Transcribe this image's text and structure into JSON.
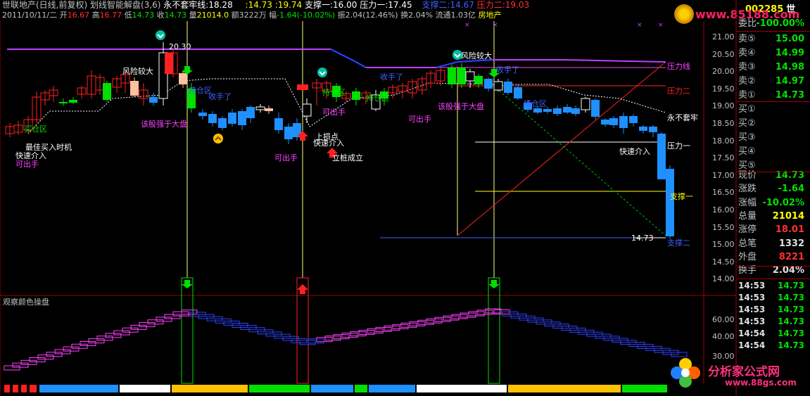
{
  "header": {
    "stock_name": "世联地产(日线,前复权)",
    "indicator": "划线智能解盘(3,6)",
    "line_label": "永不套牢线:",
    "line_value": "18.28",
    "price_value": ":14.73",
    "price_value2": ":19.74",
    "support1_label": "支撑一:",
    "support1_value": "16.00",
    "pressure1_label": "压力一:",
    "pressure1_value": "17.45",
    "support2_label": "支撑二:",
    "support2_value": "14.67",
    "pressure2_label": "压力二:",
    "pressure2_value": "19.03",
    "date": "2011/10/11/二",
    "open_label": "开",
    "open": "16.67",
    "high_label": "高",
    "high": "16.77",
    "low_label": "低",
    "low": "14.73",
    "close_label": "收",
    "close": "14.73",
    "volume_label": "量",
    "volume": "21014.0",
    "amount_label": "额",
    "amount": "3222万",
    "change_label": "幅",
    "change": "-1.64(-10.02%)",
    "amplitude_label": "振",
    "amplitude": "2.04(12.46%)",
    "turnover_label": "换",
    "turnover": "2.04%",
    "float_label": "流通",
    "float": "1.03亿",
    "sector": "房地产",
    "code": "002285",
    "code_suffix": "世"
  },
  "watermark_top": "www.85188.com",
  "axis": {
    "main": [
      "21.00",
      "20.50",
      "20.00",
      "19.50",
      "19.00",
      "18.50",
      "18.00",
      "17.50",
      "17.00",
      "16.50",
      "16.00",
      "15.50",
      "15.00",
      "14.50",
      "14.00"
    ],
    "sub": [
      "60.00",
      "40.00",
      "30.00"
    ]
  },
  "chart_labels": {
    "risk1": "风险较大",
    "risk2": "风险较大",
    "peak": "20.30",
    "stop1": "收手了",
    "stop2": "收手了",
    "stop3": "收手了",
    "hold1": "持仓区",
    "hold2": "持仓区",
    "hold3": "持仓区",
    "hold4": "持仓区",
    "strong1": "该股强于大盘",
    "strong2": "该股强于大盘",
    "can_sell1": "可出手",
    "can_sell2": "可出手",
    "can_sell3": "可出手",
    "can_sell4": "可出手",
    "quick1": "快速介入",
    "quick2": "快速介入",
    "quick3": "快速介入",
    "best_buy": "最佳买入时机",
    "up_point": "上损点",
    "stand": "立桩成立",
    "buy_zone": "买仓区",
    "right_never": "永不套牢",
    "right_p1": "压力一",
    "right_p2": "压力二",
    "right_pline": "压力线",
    "right_s1": "支撑一",
    "right_s2": "支撑二",
    "last_price": "14.73"
  },
  "sub_panel_title": "观察颜色操盘",
  "quote_panel": {
    "ratio_label": "委比",
    "ratio_value": "-100.00%",
    "sell": [
      {
        "label": "卖⑤",
        "value": "15.00"
      },
      {
        "label": "卖④",
        "value": "14.99"
      },
      {
        "label": "卖③",
        "value": "14.98"
      },
      {
        "label": "卖②",
        "value": "14.97"
      },
      {
        "label": "卖①",
        "value": "14.73"
      }
    ],
    "buy": [
      {
        "label": "买①",
        "value": ""
      },
      {
        "label": "买②",
        "value": ""
      },
      {
        "label": "买③",
        "value": ""
      },
      {
        "label": "买④",
        "value": ""
      },
      {
        "label": "买⑤",
        "value": ""
      }
    ],
    "stats": [
      {
        "label": "现价",
        "value": "14.73",
        "color": "#00e000"
      },
      {
        "label": "涨跌",
        "value": "-1.64",
        "color": "#00e000"
      },
      {
        "label": "涨幅",
        "value": "-10.02%",
        "color": "#00e000"
      },
      {
        "label": "总量",
        "value": "21014",
        "color": "#ffff00"
      },
      {
        "label": "涨停",
        "value": "18.01",
        "color": "#ff3030"
      },
      {
        "label": "总笔",
        "value": "1332",
        "color": "#e0e0e0"
      },
      {
        "label": "外盘",
        "value": "8221",
        "color": "#ff3030"
      },
      {
        "label": "换手",
        "value": "2.04%",
        "color": "#e0e0e0"
      }
    ],
    "ticks": [
      {
        "time": "14:53",
        "price": "14.73"
      },
      {
        "time": "14:53",
        "price": "14.73"
      },
      {
        "time": "14:53",
        "price": "14.73"
      },
      {
        "time": "14:53",
        "price": "14.73"
      },
      {
        "time": "14:54",
        "price": "14.73"
      },
      {
        "time": "14:54",
        "price": "14.73"
      }
    ]
  },
  "watermark_bottom": {
    "main": "分析家公式网",
    "sub": "www.88gs.com"
  },
  "colors": {
    "up": "#ff2020",
    "down": "#00dcff",
    "blue_bar": "#1e90ff",
    "green_bar": "#00e000",
    "peach": "#ffc0a0",
    "magenta": "#ff40ff",
    "purple_line": "#c040ff",
    "axis": "#a00000",
    "yellow": "#ffff00"
  }
}
